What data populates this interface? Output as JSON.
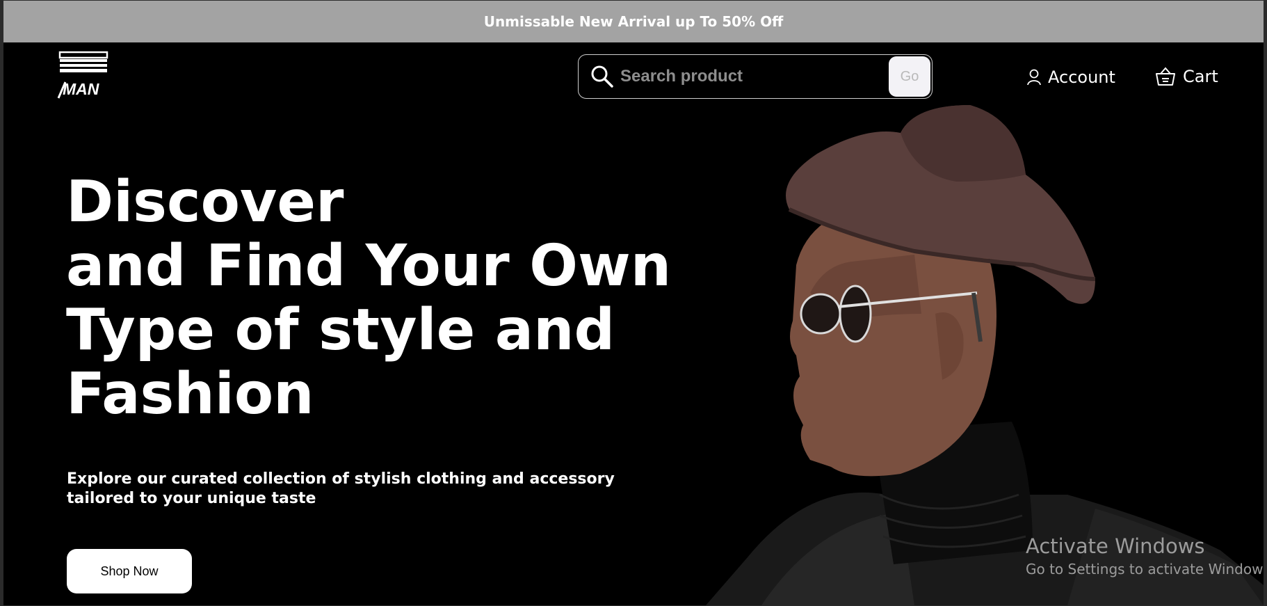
{
  "promo": {
    "text": "Unmissable New Arrival up To 50% Off"
  },
  "brand": {
    "logo_text": "MAN"
  },
  "search": {
    "placeholder": "Search product",
    "go_label": "Go"
  },
  "nav": {
    "account_label": "Account",
    "cart_label": "Cart"
  },
  "hero": {
    "title_lines": [
      "Discover",
      "and Find Your Own",
      "Type of style and",
      "Fashion"
    ],
    "subtitle": "Explore our curated collection of stylish clothing and accessory tailored to your unique taste",
    "cta_label": "Shop Now"
  },
  "watermark": {
    "title": "Activate Windows",
    "subtitle": "Go to Settings to activate Windows."
  },
  "colors": {
    "promo_bg": "#a3a3a3",
    "page_bg": "#000000",
    "text": "#ffffff",
    "hat": "#5a3f3c",
    "skin": "#7a5040"
  },
  "icons": {
    "search": "search-icon",
    "account": "user-icon",
    "cart": "basket-icon"
  }
}
